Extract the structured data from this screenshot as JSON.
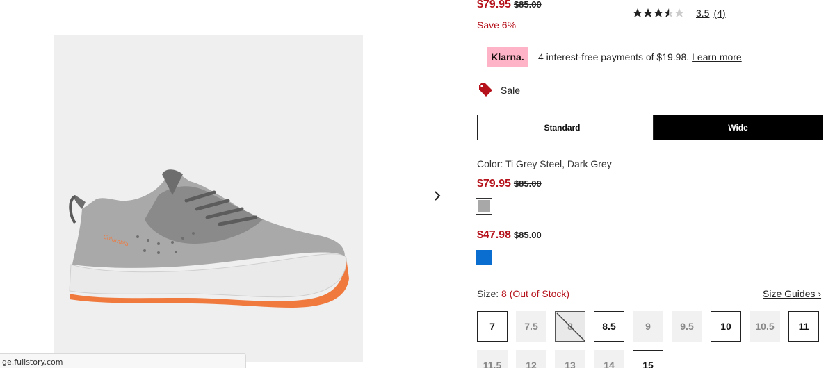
{
  "status_url": "ge.fullstory.com",
  "price": {
    "sale": "$79.95",
    "original": "$85.00",
    "save": "Save 6%"
  },
  "rating": {
    "score": "3.5",
    "count": "(4)",
    "stars": 3.5
  },
  "klarna": {
    "badge": "Klarna.",
    "text": "4 interest-free payments of $19.98.",
    "link": "Learn more"
  },
  "sale_tag": "Sale",
  "widths": {
    "standard": "Standard",
    "wide": "Wide"
  },
  "color": {
    "label": "Color: Ti Grey Steel, Dark Grey",
    "options": [
      {
        "sale": "$79.95",
        "original": "$85.00",
        "swatch": "#a8a8a8"
      },
      {
        "sale": "$47.98",
        "original": "$85.00",
        "swatch": "#0a6ed1"
      }
    ]
  },
  "size": {
    "label": "Size:",
    "selected": "8 (Out of Stock)",
    "guides": "Size Guides ›",
    "options": [
      {
        "label": "7",
        "state": "in"
      },
      {
        "label": "7.5",
        "state": "out"
      },
      {
        "label": "8",
        "state": "selected"
      },
      {
        "label": "8.5",
        "state": "in"
      },
      {
        "label": "9",
        "state": "out"
      },
      {
        "label": "9.5",
        "state": "out"
      },
      {
        "label": "10",
        "state": "in"
      },
      {
        "label": "10.5",
        "state": "out"
      },
      {
        "label": "11",
        "state": "in"
      },
      {
        "label": "11.5",
        "state": "out"
      },
      {
        "label": "12",
        "state": "out"
      },
      {
        "label": "13",
        "state": "out"
      },
      {
        "label": "14",
        "state": "out"
      },
      {
        "label": "15",
        "state": "in"
      }
    ]
  },
  "colors": {
    "sale_red": "#b5121b",
    "klarna_pink": "#ffb3c7",
    "accent_orange": "#f07a3e"
  },
  "icons": {
    "next": "chevron-right-icon",
    "sale": "price-tag-icon"
  }
}
